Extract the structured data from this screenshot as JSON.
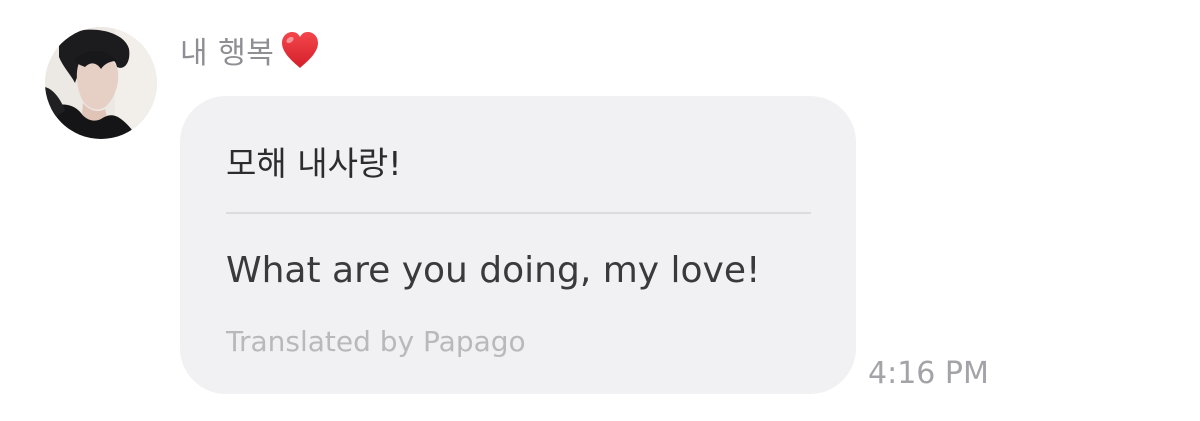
{
  "message": {
    "sender_name": "내 행복",
    "sender_emoji": "heart-emoji",
    "original_text": "모해 내사랑!",
    "translated_text": "What are you doing, my love!",
    "translation_credit": "Translated by Papago",
    "timestamp": "4:16 PM"
  },
  "colors": {
    "bubble": "#f1f1f3",
    "sender_name": "#8e8e93",
    "message_text": "#2c2c2e",
    "credit_text": "#b8b8bd",
    "timestamp": "#a3a3a8",
    "heart": "#e0242c"
  }
}
